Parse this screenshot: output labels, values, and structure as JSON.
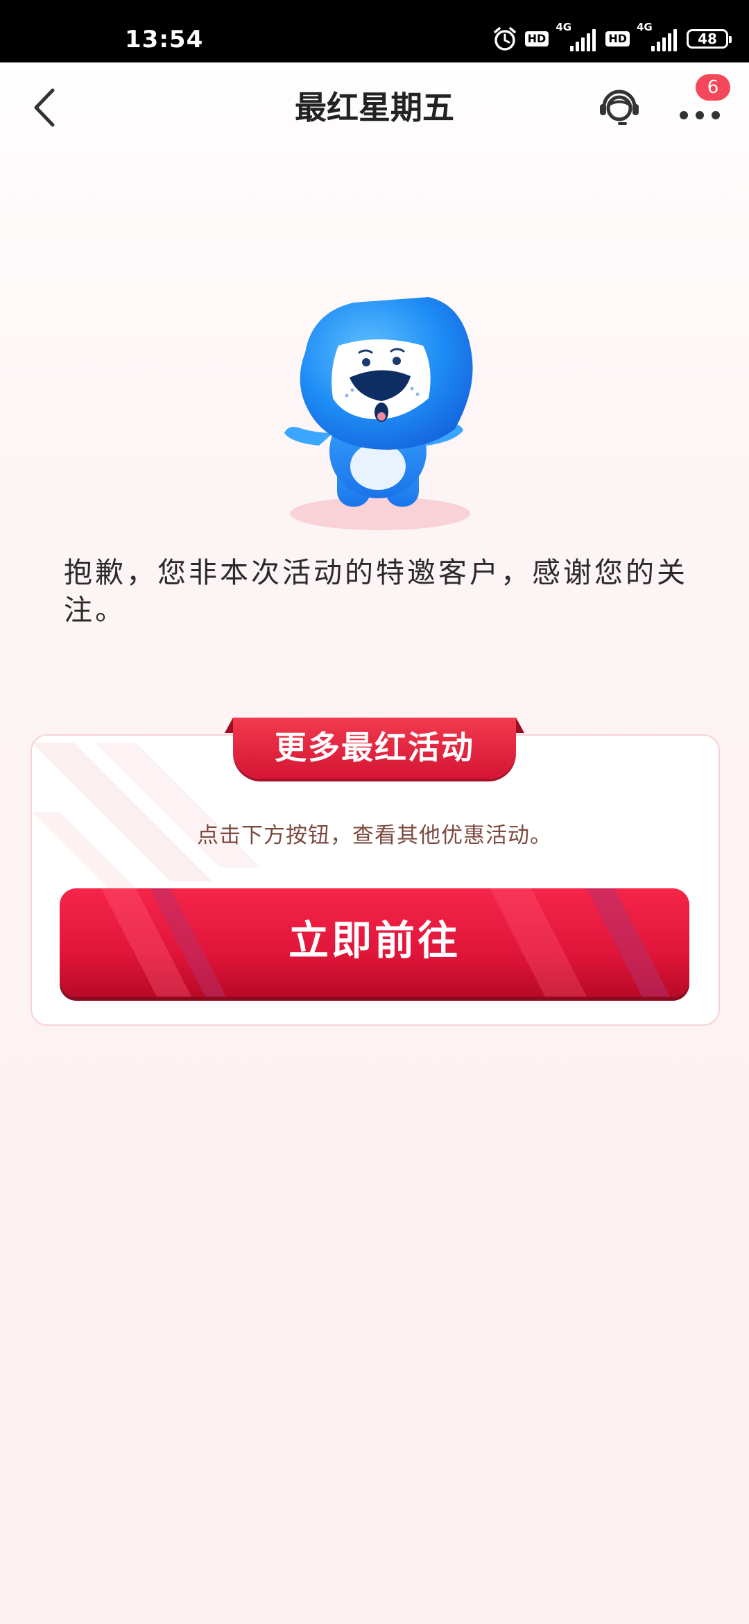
{
  "status_bar": {
    "time": "13:54",
    "hd_label_1": "HD",
    "network_1": "4G",
    "hd_label_2": "HD",
    "network_2": "4G",
    "battery": "48"
  },
  "header": {
    "title": "最红星期五",
    "more_badge": "6"
  },
  "main": {
    "message": "抱歉，您非本次活动的特邀客户，感谢您的关注。"
  },
  "promo_card": {
    "heading": "更多最红活动",
    "description": "点击下方按钮，查看其他优惠活动。",
    "button_label": "立即前往"
  },
  "colors": {
    "accent_red": "#e0153a",
    "badge_red": "#f5475a",
    "mascot_blue": "#1e8cf5"
  },
  "icons": {
    "back": "chevron-left-icon",
    "service": "customer-service-headset-icon",
    "more": "more-dots-icon"
  }
}
